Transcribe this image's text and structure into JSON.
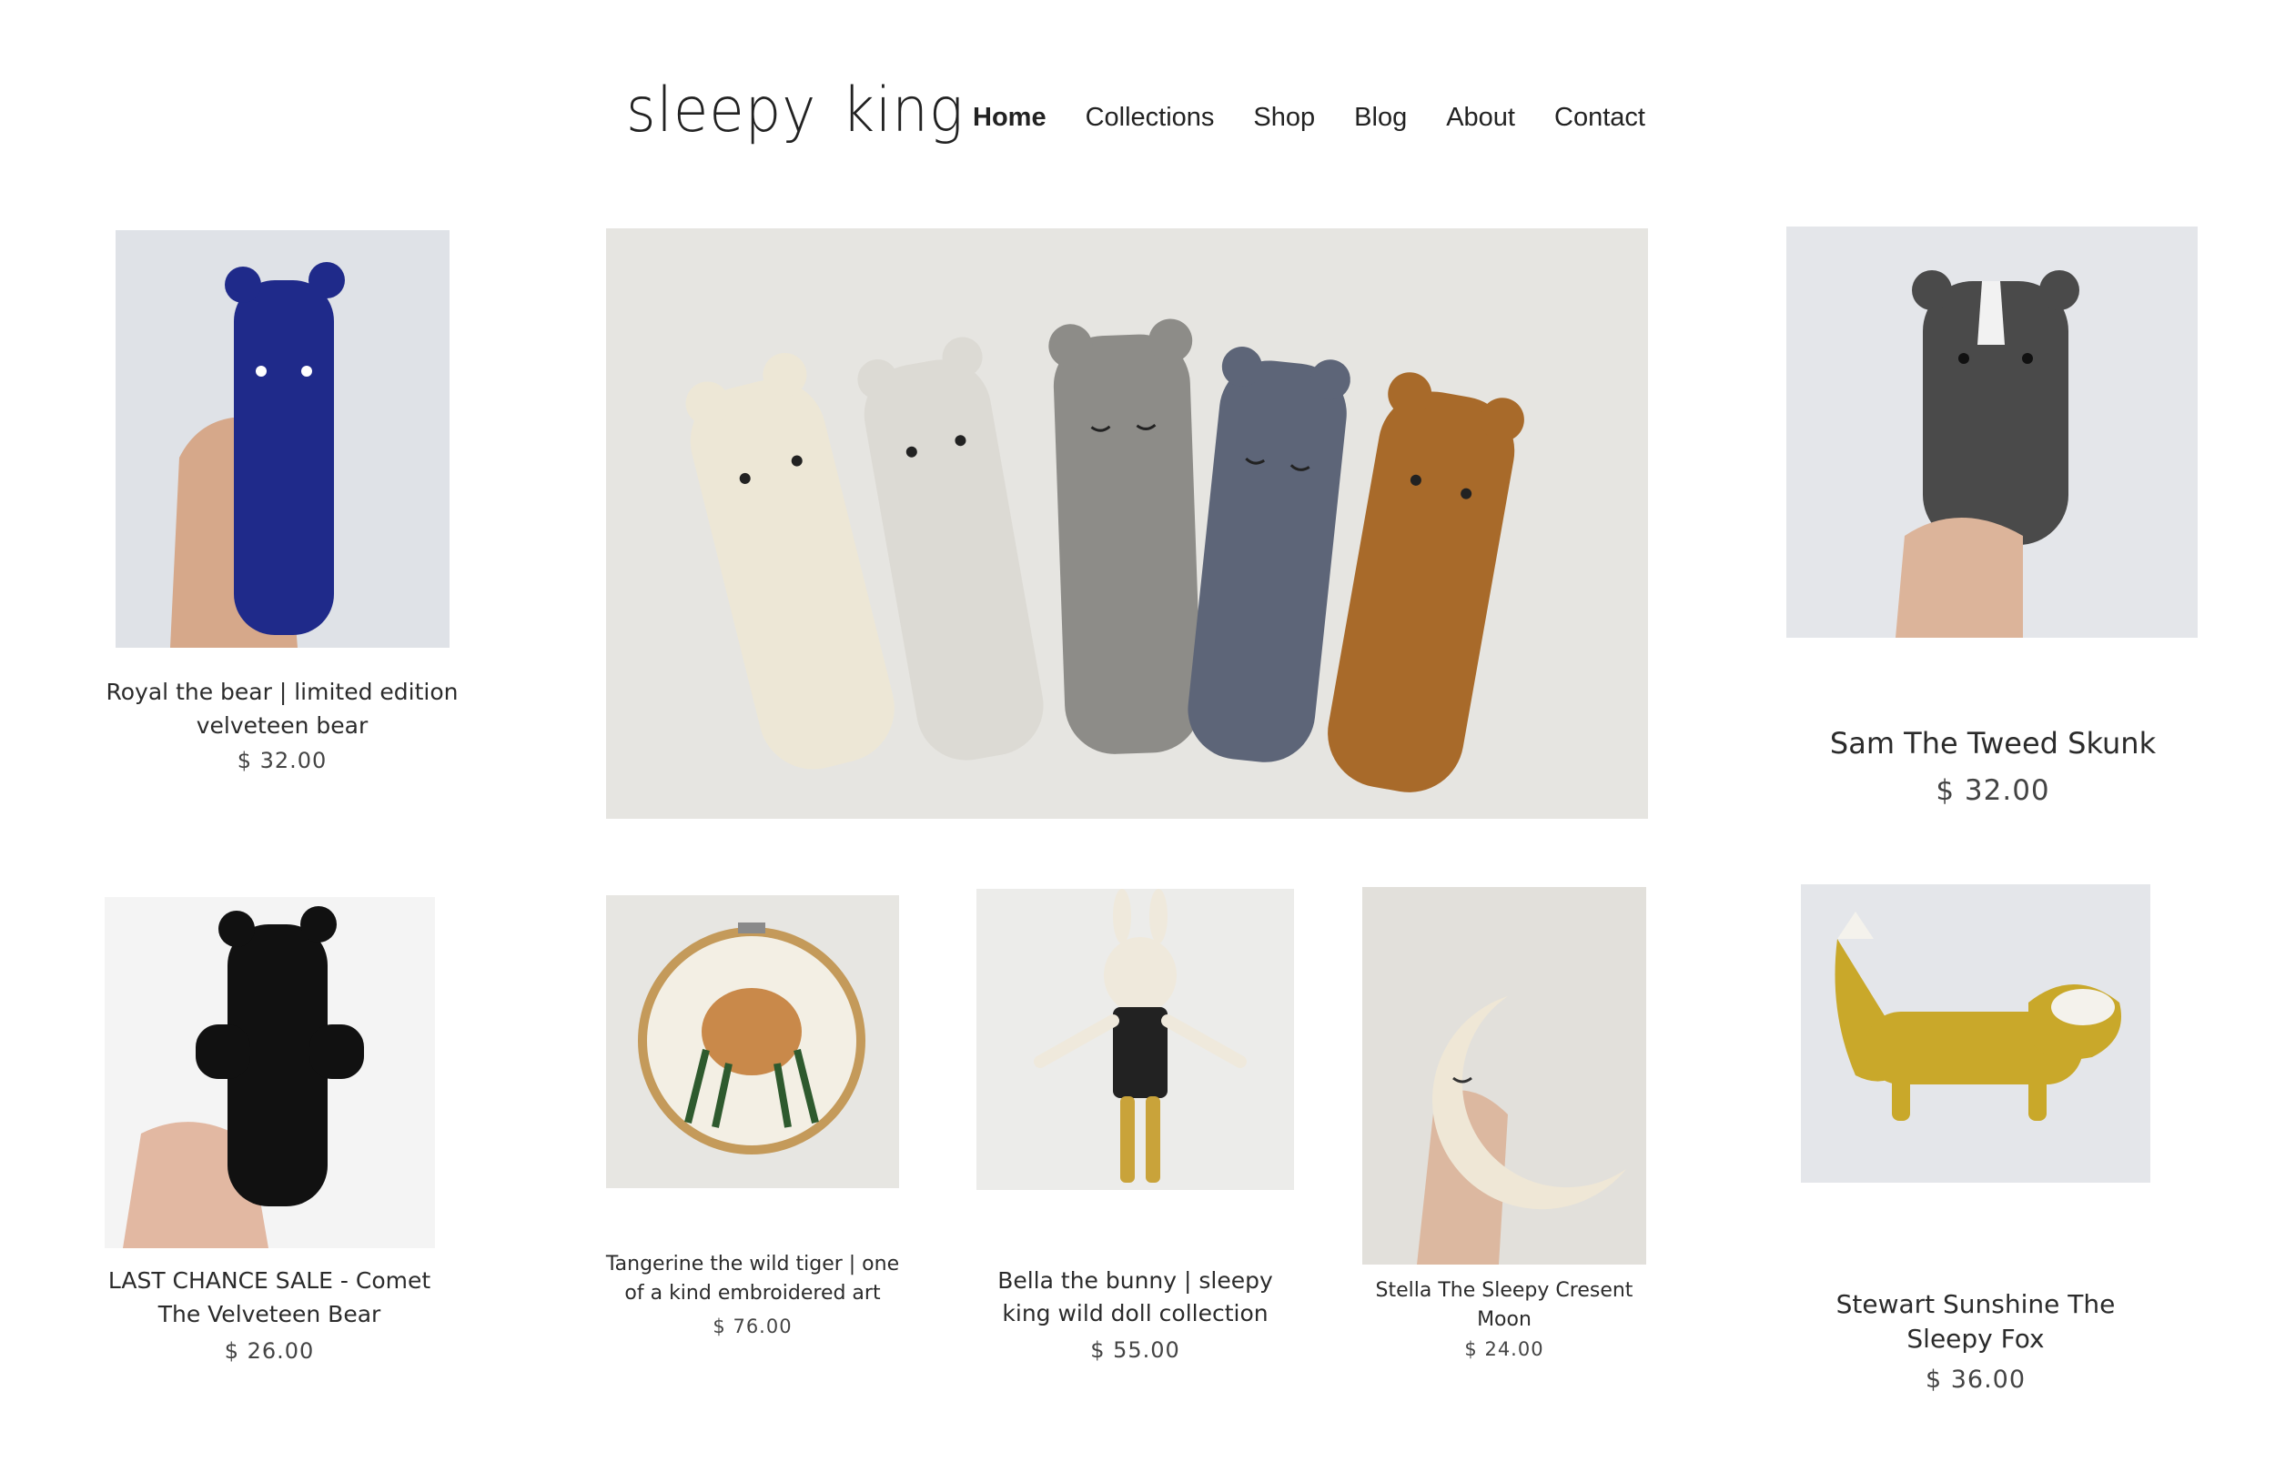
{
  "header": {
    "logo_word1": "sleepy",
    "logo_word2": "king",
    "nav": [
      {
        "label": "Home",
        "active": true
      },
      {
        "label": "Collections"
      },
      {
        "label": "Shop"
      },
      {
        "label": "Blog"
      },
      {
        "label": "About"
      },
      {
        "label": "Contact"
      }
    ]
  },
  "products": [
    {
      "title": "Royal the bear | limited edition velveteen bear",
      "price": "$ 32.00"
    },
    {
      "title": "Sam The Tweed Skunk",
      "price": "$ 32.00"
    },
    {
      "title": "LAST CHANCE SALE - Comet The Velveteen Bear",
      "price": "$ 26.00"
    },
    {
      "title": "Tangerine the wild tiger | one of a kind embroidered art",
      "price": "$ 76.00"
    },
    {
      "title": "Bella the bunny | sleepy king wild doll collection",
      "price": "$ 55.00"
    },
    {
      "title": "Stella The Sleepy Cresent Moon",
      "price": "$ 24.00"
    },
    {
      "title": "Stewart Sunshine The Sleepy Fox",
      "price": "$ 36.00"
    }
  ],
  "colors": {
    "royal_bear": "#1f2a8a",
    "skunk_tweed": "#4a4a4a",
    "comet_bear": "#111111",
    "tiger": "#c9894a",
    "bunny_legs": "#c9a33a",
    "moon": "#efe7d6",
    "fox": "#c9a82a",
    "bear_cream": "#ece6d6",
    "bear_light": "#dcdad4",
    "bear_grey": "#8d8c88",
    "bear_blue": "#5d6578",
    "bear_rust": "#a86a2a"
  }
}
